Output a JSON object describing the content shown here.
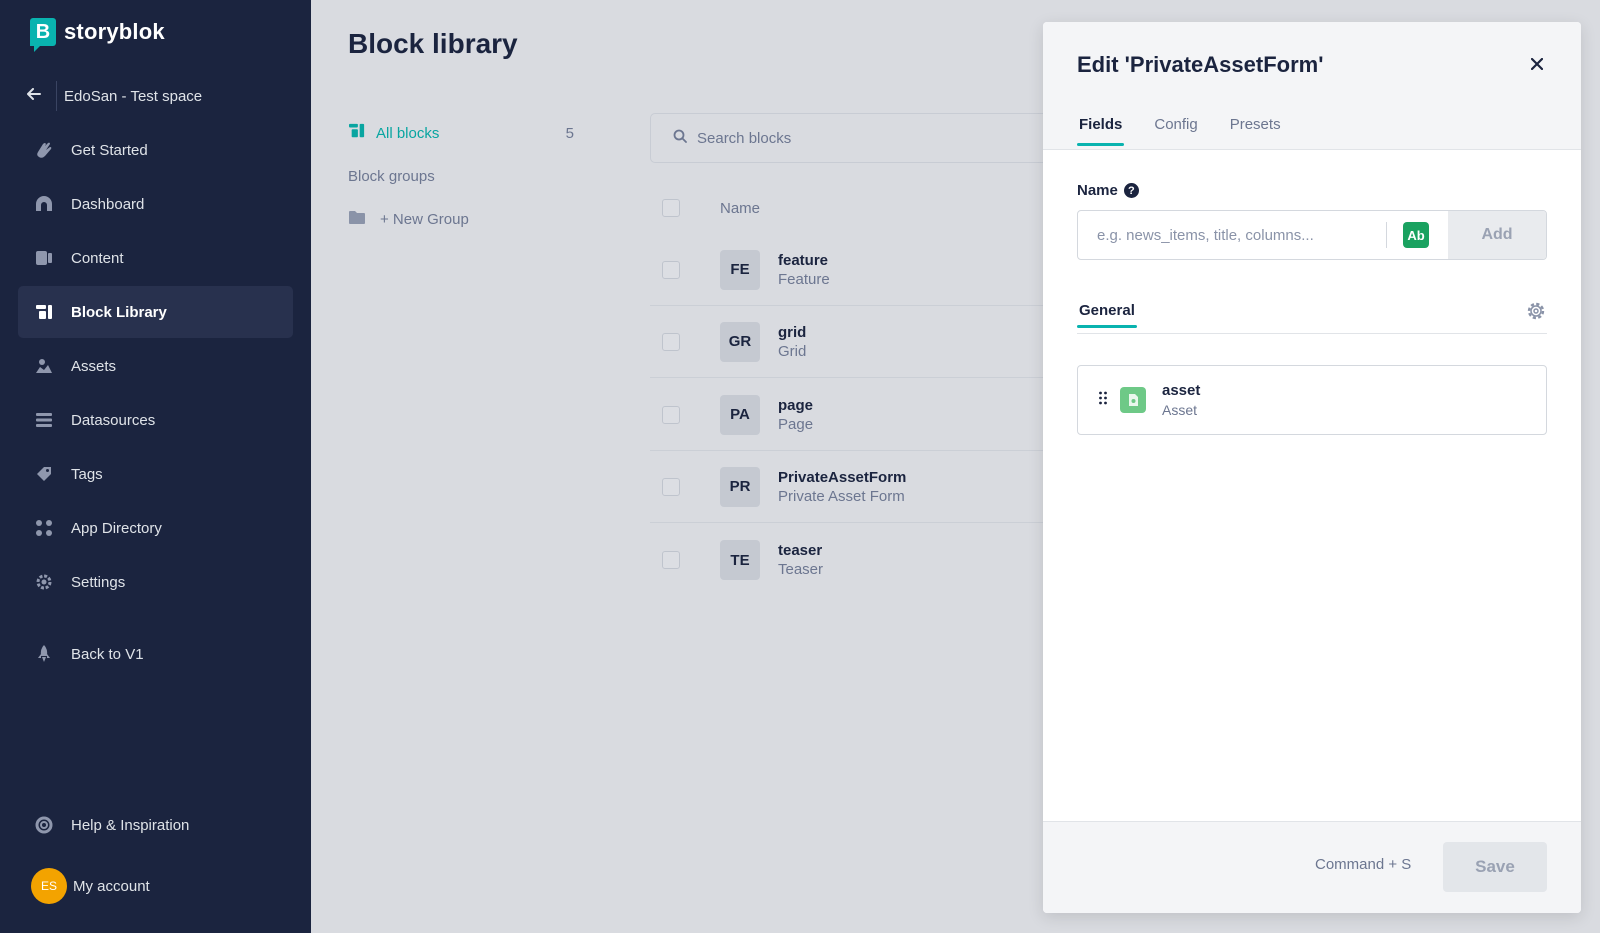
{
  "brand": {
    "name": "storyblok",
    "logo_letter": "B",
    "accent": "#09b3af"
  },
  "sidebar": {
    "space": {
      "name": "EdoSan - Test space"
    },
    "items": [
      {
        "label": "Get Started",
        "icon": "hand-wave-icon"
      },
      {
        "label": "Dashboard",
        "icon": "dashboard-icon"
      },
      {
        "label": "Content",
        "icon": "content-icon"
      },
      {
        "label": "Block Library",
        "icon": "block-library-icon",
        "active": true
      },
      {
        "label": "Assets",
        "icon": "assets-icon"
      },
      {
        "label": "Datasources",
        "icon": "datasources-icon"
      },
      {
        "label": "Tags",
        "icon": "tags-icon"
      },
      {
        "label": "App Directory",
        "icon": "app-directory-icon"
      },
      {
        "label": "Settings",
        "icon": "settings-icon"
      },
      {
        "label": "Back to V1",
        "icon": "rocket-icon"
      }
    ],
    "help": {
      "label": "Help & Inspiration"
    },
    "account": {
      "label": "My account",
      "initials": "ES"
    }
  },
  "main": {
    "title": "Block library",
    "filters": {
      "all_label": "All blocks",
      "all_count": "5",
      "groups_label": "Block groups",
      "new_group_label": "+ New Group"
    },
    "search": {
      "placeholder": "Search blocks"
    },
    "list": {
      "header_name": "Name",
      "rows": [
        {
          "badge": "FE",
          "name": "feature",
          "display": "Feature"
        },
        {
          "badge": "GR",
          "name": "grid",
          "display": "Grid"
        },
        {
          "badge": "PA",
          "name": "page",
          "display": "Page"
        },
        {
          "badge": "PR",
          "name": "PrivateAssetForm",
          "display": "Private Asset Form"
        },
        {
          "badge": "TE",
          "name": "teaser",
          "display": "Teaser"
        }
      ]
    }
  },
  "modal": {
    "title": "Edit 'PrivateAssetForm'",
    "tabs": [
      {
        "label": "Fields",
        "active": true
      },
      {
        "label": "Config"
      },
      {
        "label": "Presets"
      }
    ],
    "name_field": {
      "label": "Name",
      "help": "?",
      "placeholder": "e.g. news_items, title, columns...",
      "type_chip": "Ab",
      "add_label": "Add"
    },
    "section_tab": "General",
    "fields": [
      {
        "name": "asset",
        "type": "Asset"
      }
    ],
    "footer": {
      "shortcut": "Command + S",
      "save_label": "Save"
    }
  }
}
